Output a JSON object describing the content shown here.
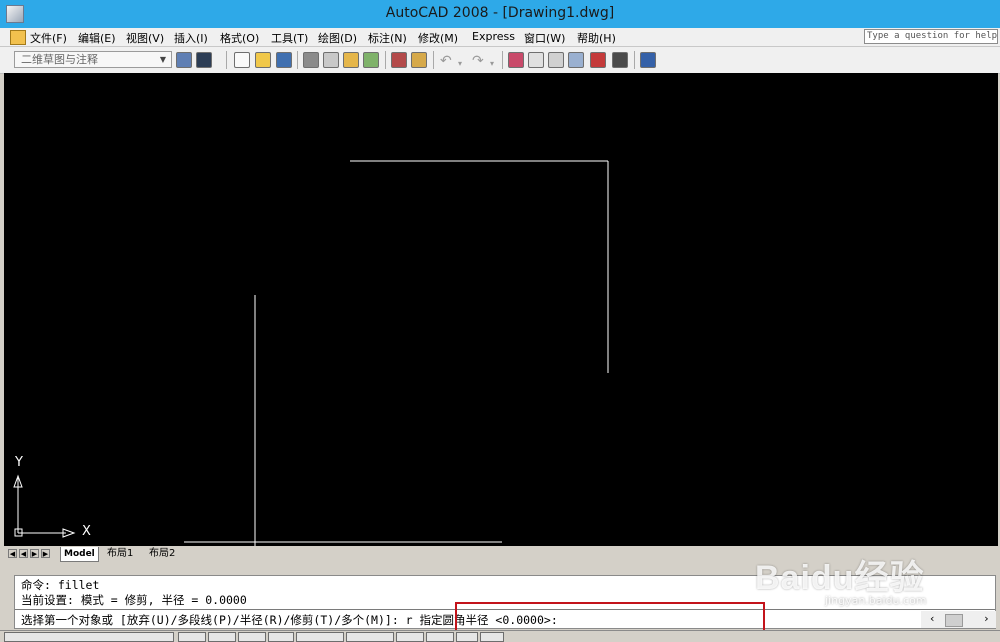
{
  "window": {
    "title": "AutoCAD 2008 - [Drawing1.dwg]"
  },
  "menu": [
    "文件(F)",
    "编辑(E)",
    "视图(V)",
    "插入(I)",
    "格式(O)",
    "工具(T)",
    "绘图(D)",
    "标注(N)",
    "修改(M)",
    "Express",
    "窗口(W)",
    "帮助(H)"
  ],
  "help_search": {
    "placeholder": "Type a question for help"
  },
  "toolbar": {
    "workspace": "二维草图与注释"
  },
  "viewport": {
    "background": "#000000",
    "ucs": {
      "x_label": "X",
      "y_label": "Y"
    }
  },
  "layout_tabs": [
    "Model",
    "布局1",
    "布局2"
  ],
  "command": {
    "line1": "命令:  fillet",
    "line2": "当前设置: 模式 = 修剪, 半径 = 0.0000",
    "line3": "选择第一个对象或 [放弃(U)/多段线(P)/半径(R)/修剪(T)/多个(M)]: r 指定圆角半径 <0.0000>:"
  },
  "colors": {
    "title_bar": "#2ea9e8",
    "highlight_box": "#c3141b"
  },
  "watermark": {
    "brand": "Baidu经验",
    "url": "jingyan.baidu.com"
  }
}
